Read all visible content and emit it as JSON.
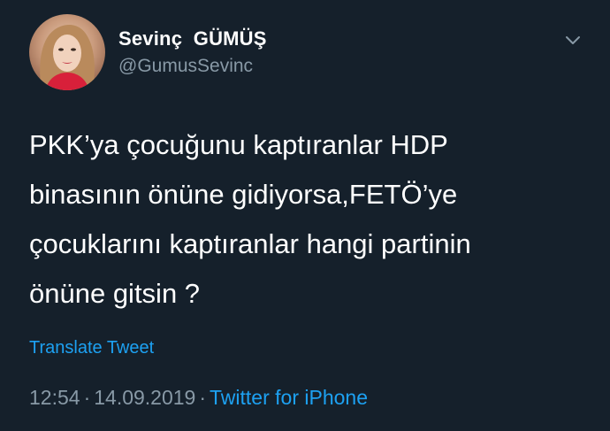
{
  "user": {
    "display_name": "Sevinç  GÜMÜŞ",
    "handle": "@GumusSevinc"
  },
  "tweet": {
    "text": "PKK’ya çocuğunu kaptıranlar HDP\nbinasının önüne gidiyorsa,FETÖ’ye\nçocuklarını kaptıranlar hangi partinin\nönüne gitsin ?",
    "translate_label": "Translate Tweet",
    "time": "12:54",
    "separator": "·",
    "date": "14.09.2019",
    "source": "Twitter for iPhone"
  },
  "icons": {
    "caret": "chevron-down-icon",
    "avatar": "profile-photo"
  },
  "colors": {
    "background": "#15202b",
    "text": "#ffffff",
    "muted": "#8899a6",
    "accent": "#1da1f2"
  }
}
